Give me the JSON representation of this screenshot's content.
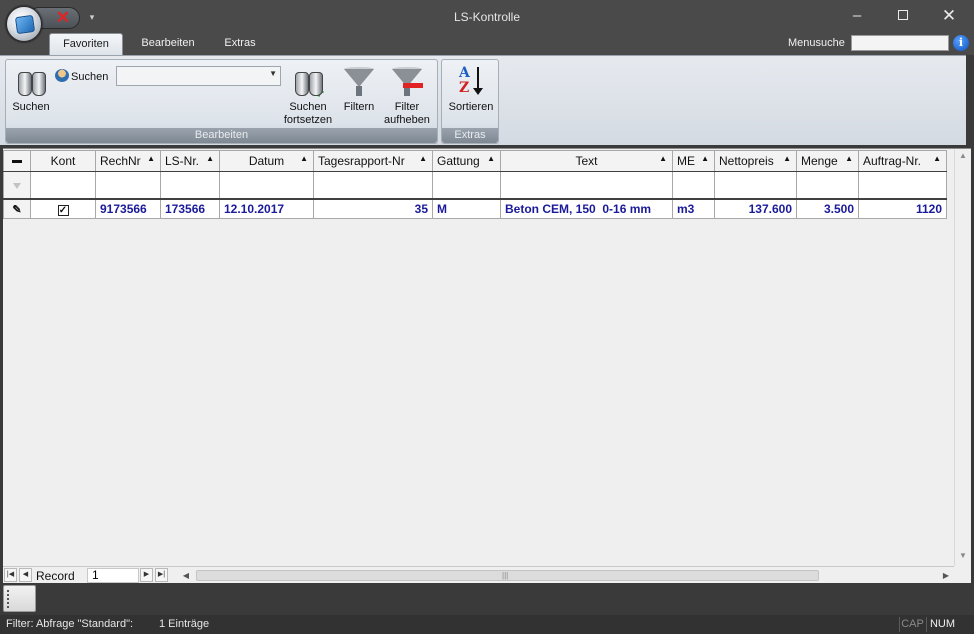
{
  "window": {
    "title": "LS-Kontrolle",
    "minimize": "–",
    "close": "✕"
  },
  "quick_access": {
    "close_glyph": "✕",
    "dropdown_glyph": "▾"
  },
  "ribbon_tabs": [
    {
      "label": "Favoriten",
      "active": true
    },
    {
      "label": "Bearbeiten",
      "active": false
    },
    {
      "label": "Extras",
      "active": false
    }
  ],
  "menusuche": {
    "label": "Menusuche",
    "value": "",
    "info_glyph": "i"
  },
  "groups": {
    "bearbeiten": {
      "label": "Bearbeiten",
      "suchen_button": "Suchen",
      "suchen_small": "Suchen",
      "search_combo_value": "",
      "suchen_fortsetzen_line1": "Suchen",
      "suchen_fortsetzen_line2": "fortsetzen",
      "filtern": "Filtern",
      "filter_aufheben_line1": "Filter",
      "filter_aufheben_line2": "aufheben"
    },
    "extras": {
      "label": "Extras",
      "sortieren": "Sortieren",
      "sort_icon_a": "A",
      "sort_icon_z": "Z"
    }
  },
  "grid": {
    "columns": [
      {
        "label": "Kont",
        "sortable": false
      },
      {
        "label": "RechNr",
        "sortable": true
      },
      {
        "label": "LS-Nr.",
        "sortable": true
      },
      {
        "label": "Datum",
        "sortable": true
      },
      {
        "label": "Tagesrapport-Nr",
        "sortable": true
      },
      {
        "label": "Gattung",
        "sortable": true
      },
      {
        "label": "Text",
        "sortable": true
      },
      {
        "label": "ME",
        "sortable": true
      },
      {
        "label": "Nettopreis",
        "sortable": true
      },
      {
        "label": "Menge",
        "sortable": true
      },
      {
        "label": "Auftrag-Nr.",
        "sortable": true
      }
    ],
    "rows": [
      {
        "kont_checked": true,
        "kont_glyph": "✓",
        "rechnr": "9173566",
        "lsnr": "173566",
        "datum": "12.10.2017",
        "tagesrapport_nr": "35",
        "gattung": "M",
        "text": "Beton CEM, 150  0-16 mm",
        "me": "m3",
        "nettopreis": "137.600",
        "menge": "3.500",
        "auftrag_nr": "1120"
      }
    ],
    "sort_glyph": "▲"
  },
  "navigator": {
    "label": "Record",
    "value": "1"
  },
  "status": {
    "filter": "Filter: Abfrage \"Standard\":",
    "count": "1 Einträge",
    "cap": "CAP",
    "num": "NUM"
  },
  "colors": {
    "data_text": "#1a1a9a",
    "title_bar": "#4a4a4a",
    "ribbon_group_label": "#8b949e"
  }
}
